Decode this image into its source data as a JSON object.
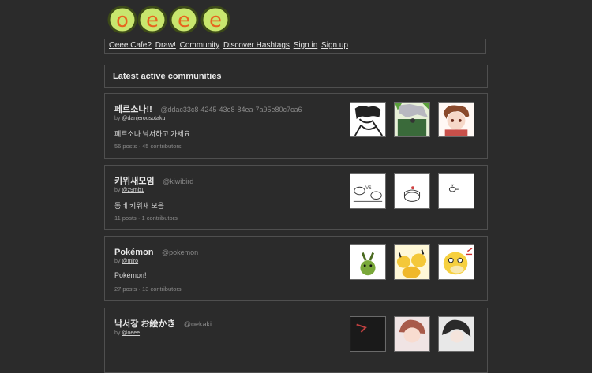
{
  "logo": {
    "text": "Oeee",
    "colors": {
      "fill": "#c8e66e",
      "stroke": "#4a5a1e",
      "letter": "#e8641e"
    }
  },
  "nav": {
    "items": [
      "Oeee Cafe?",
      "Draw!",
      "Community",
      "Discover Hashtags",
      "Sign in",
      "Sign up"
    ]
  },
  "section": {
    "title": "Latest active communities"
  },
  "communities": [
    {
      "name": "페르소나!!",
      "handle": "@ddac33c8-4245-43e8-84ea-7a95e80c7ca6",
      "by_prefix": "by",
      "owner": "@danjerousotaku",
      "description": "페르소나 낙서하고 가세요",
      "stats": "56 posts · 45 contributors",
      "thumbnails": [
        "manga-man-sketch",
        "silver-hair-character",
        "brown-hair-girl"
      ]
    },
    {
      "name": "키위새모임",
      "handle": "@kiwibird",
      "by_prefix": "by",
      "owner": "@z9mb1",
      "description": "동네 키위새 모음",
      "stats": "11 posts · 1 contributors",
      "thumbnails": [
        "kiwi-vs-sketch",
        "cake-sketch",
        "small-kiwi-sketch"
      ]
    },
    {
      "name": "Pokémon",
      "handle": "@pokemon",
      "by_prefix": "by",
      "owner": "@miro",
      "description": "Pokémon!",
      "stats": "27 posts · 13 contributors",
      "thumbnails": [
        "green-creature",
        "pikachu-group",
        "psyduck"
      ]
    },
    {
      "name": "낙서장 お絵かき",
      "handle": "@oekaki",
      "by_prefix": "by",
      "owner": "@oeee",
      "description": "",
      "stats": "",
      "thumbnails": [
        "dark-drawing",
        "anime-girl",
        "dark-hair-character"
      ]
    }
  ]
}
